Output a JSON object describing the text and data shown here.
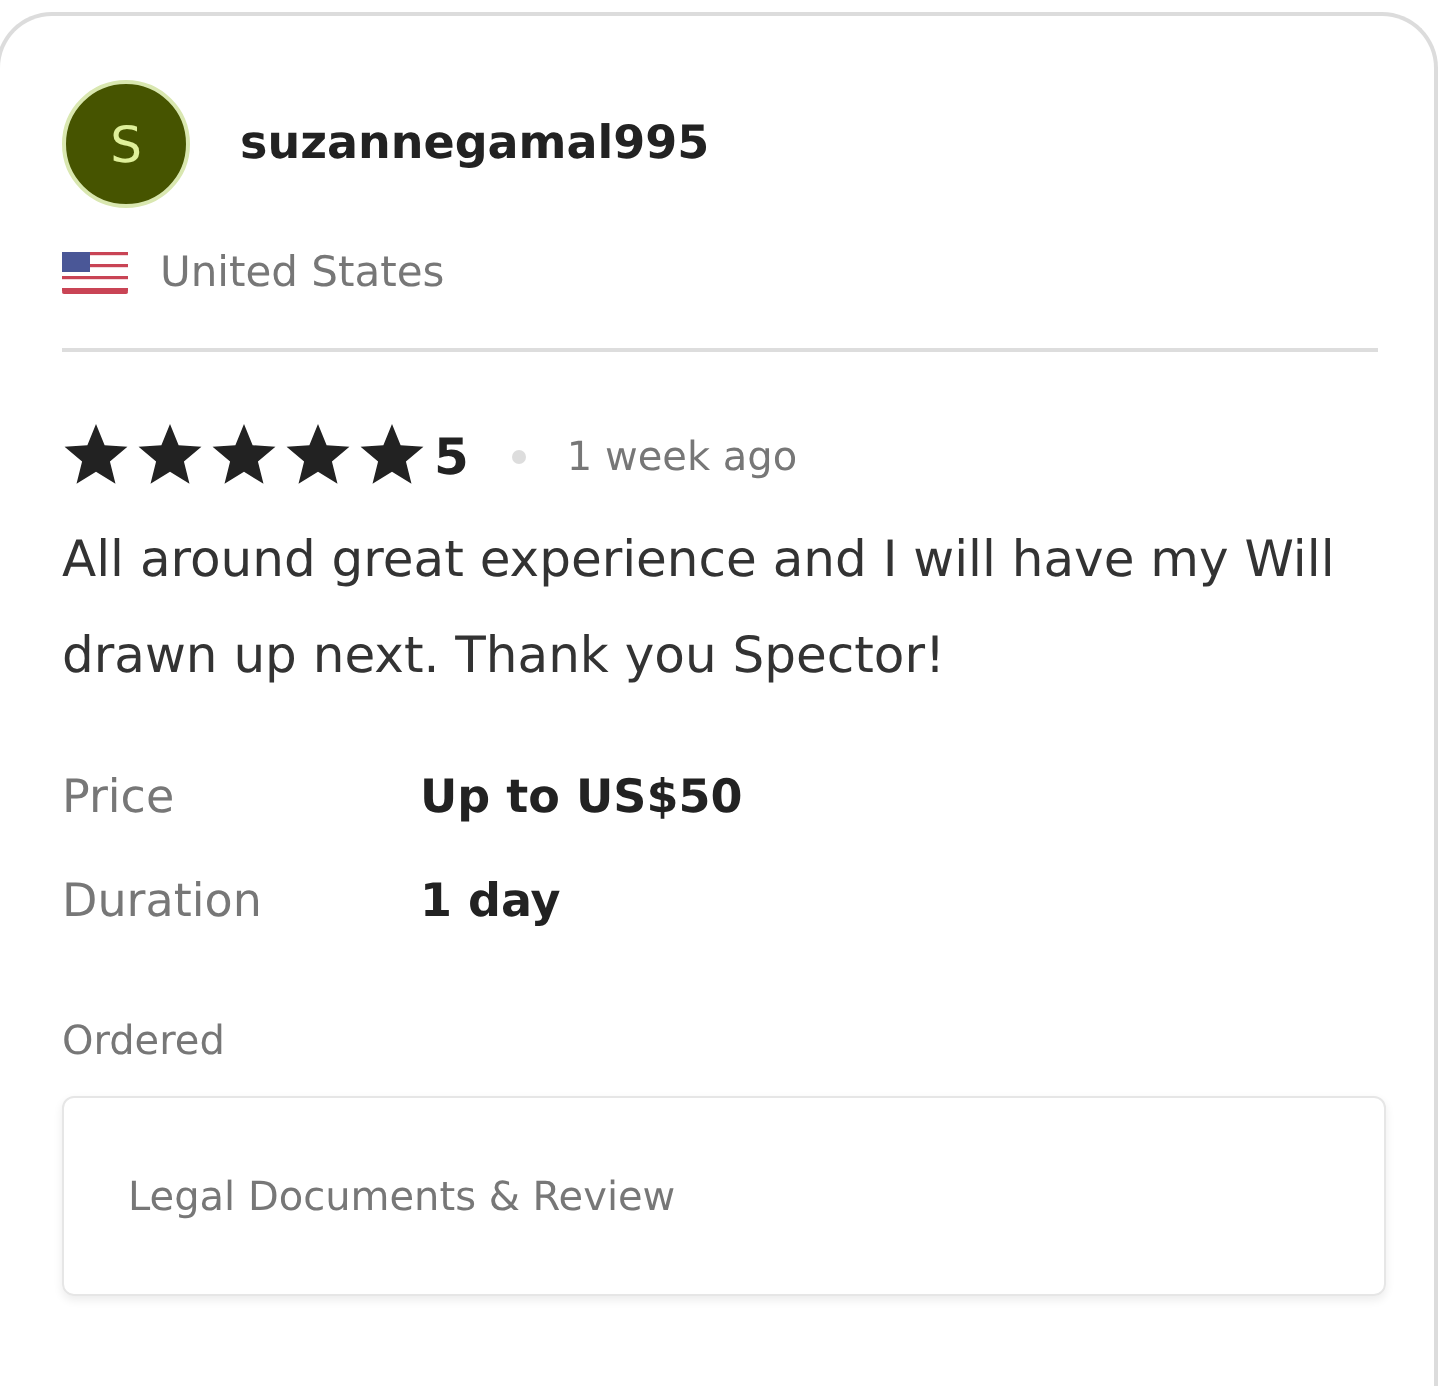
{
  "reviewer": {
    "avatar_letter": "S",
    "name": "suzannegamal995",
    "country": "United States"
  },
  "review": {
    "stars": 5,
    "rating": "5",
    "time": "1 week ago",
    "text": "All around great experience and I will have my Will drawn up next. Thank you Spector!"
  },
  "details": [
    {
      "label": "Price",
      "value": "Up to US$50"
    },
    {
      "label": "Duration",
      "value": "1 day"
    }
  ],
  "ordered": {
    "label": "Ordered",
    "item": "Legal Documents & Review"
  }
}
